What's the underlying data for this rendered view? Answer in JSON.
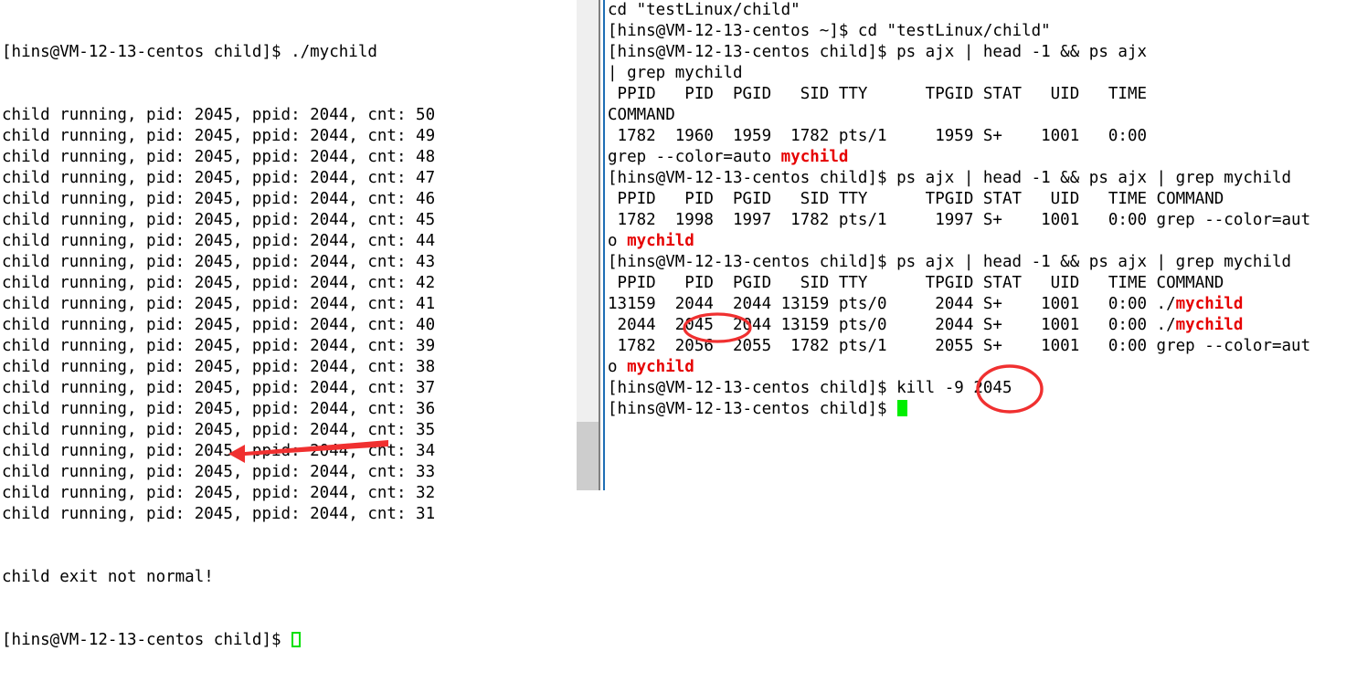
{
  "terminal": {
    "prompt_home": "[hins@VM-12-13-centos ~]$ ",
    "prompt_child": "[hins@VM-12-13-centos child]$ ",
    "highlight_color": "#e60000",
    "cursor_color": "#00ee00"
  },
  "left_pane": {
    "name": "child-process-output-pane",
    "command_line": "[hins@VM-12-13-centos child]$ ./mychild",
    "run_lines": [
      "child running, pid: 2045, ppid: 2044, cnt: 50",
      "child running, pid: 2045, ppid: 2044, cnt: 49",
      "child running, pid: 2045, ppid: 2044, cnt: 48",
      "child running, pid: 2045, ppid: 2044, cnt: 47",
      "child running, pid: 2045, ppid: 2044, cnt: 46",
      "child running, pid: 2045, ppid: 2044, cnt: 45",
      "child running, pid: 2045, ppid: 2044, cnt: 44",
      "child running, pid: 2045, ppid: 2044, cnt: 43",
      "child running, pid: 2045, ppid: 2044, cnt: 42",
      "child running, pid: 2045, ppid: 2044, cnt: 41",
      "child running, pid: 2045, ppid: 2044, cnt: 40",
      "child running, pid: 2045, ppid: 2044, cnt: 39",
      "child running, pid: 2045, ppid: 2044, cnt: 38",
      "child running, pid: 2045, ppid: 2044, cnt: 37",
      "child running, pid: 2045, ppid: 2044, cnt: 36",
      "child running, pid: 2045, ppid: 2044, cnt: 35",
      "child running, pid: 2045, ppid: 2044, cnt: 34",
      "child running, pid: 2045, ppid: 2044, cnt: 33",
      "child running, pid: 2045, ppid: 2044, cnt: 32",
      "child running, pid: 2045, ppid: 2044, cnt: 31"
    ],
    "exit_message": "child exit not normal!",
    "final_prompt": "[hins@VM-12-13-centos child]$ "
  },
  "right_pane": {
    "name": "ps-monitor-pane",
    "lines": [
      {
        "id": "l01",
        "segments": [
          {
            "t": "cd \"testLinux/child\""
          }
        ]
      },
      {
        "id": "l02",
        "segments": [
          {
            "t": "[hins@VM-12-13-centos ~]$ cd \"testLinux/child\""
          }
        ]
      },
      {
        "id": "l03",
        "segments": [
          {
            "t": "[hins@VM-12-13-centos child]$ ps ajx | head -1 && ps ajx"
          }
        ]
      },
      {
        "id": "l04",
        "segments": [
          {
            "t": "| grep mychild"
          }
        ]
      },
      {
        "id": "l05",
        "segments": [
          {
            "t": " PPID   PID  PGID   SID TTY      TPGID STAT   UID   TIME"
          }
        ]
      },
      {
        "id": "l06",
        "segments": [
          {
            "t": "COMMAND"
          }
        ]
      },
      {
        "id": "l07",
        "segments": [
          {
            "t": " 1782  1960  1959  1782 pts/1     1959 S+    1001   0:00 "
          }
        ]
      },
      {
        "id": "l08",
        "segments": [
          {
            "t": "grep --color=auto "
          },
          {
            "t": "mychild",
            "c": "red"
          }
        ]
      },
      {
        "id": "l09",
        "segments": [
          {
            "t": "[hins@VM-12-13-centos child]$ ps ajx | head -1 && ps ajx | grep mychild"
          }
        ]
      },
      {
        "id": "l10",
        "segments": [
          {
            "t": " PPID   PID  PGID   SID TTY      TPGID STAT   UID   TIME COMMAND"
          }
        ]
      },
      {
        "id": "l11",
        "segments": [
          {
            "t": " 1782  1998  1997  1782 pts/1     1997 S+    1001   0:00 grep --color=aut"
          }
        ]
      },
      {
        "id": "l12",
        "segments": [
          {
            "t": "o "
          },
          {
            "t": "mychild",
            "c": "red"
          }
        ]
      },
      {
        "id": "l13",
        "segments": [
          {
            "t": "[hins@VM-12-13-centos child]$ ps ajx | head -1 && ps ajx | grep mychild"
          }
        ]
      },
      {
        "id": "l14",
        "segments": [
          {
            "t": " PPID   PID  PGID   SID TTY      TPGID STAT   UID   TIME COMMAND"
          }
        ]
      },
      {
        "id": "l15",
        "segments": [
          {
            "t": "13159  2044  2044 13159 pts/0     2044 S+    1001   0:00 ./"
          },
          {
            "t": "mychild",
            "c": "red"
          }
        ]
      },
      {
        "id": "l16",
        "segments": [
          {
            "t": " 2044  2045  2044 13159 pts/0     2044 S+    1001   0:00 ./"
          },
          {
            "t": "mychild",
            "c": "red"
          }
        ]
      },
      {
        "id": "l17",
        "segments": [
          {
            "t": " 1782  2056  2055  1782 pts/1     2055 S+    1001   0:00 grep --color=aut"
          }
        ]
      },
      {
        "id": "l18",
        "segments": [
          {
            "t": "o "
          },
          {
            "t": "mychild",
            "c": "red"
          }
        ]
      },
      {
        "id": "l19",
        "segments": [
          {
            "t": "[hins@VM-12-13-centos child]$ kill -9 2045"
          }
        ]
      },
      {
        "id": "l20",
        "segments": [
          {
            "t": "[hins@VM-12-13-centos child]$ "
          },
          {
            "cursor": "solid"
          }
        ]
      }
    ]
  },
  "annotations": {
    "color": "#f03030",
    "arrow": {
      "name": "red-arrow-pointing-at-exit-message",
      "target_text": "child exit not normal!"
    },
    "ellipse_pid": {
      "name": "red-ellipse-around-child-pid",
      "target_text": "2045"
    },
    "circle_kill": {
      "name": "red-circle-around-kill-target-pid",
      "target_text": "2045"
    }
  },
  "scrollbar": {
    "name": "vertical-scrollbar",
    "position": "bottom"
  }
}
